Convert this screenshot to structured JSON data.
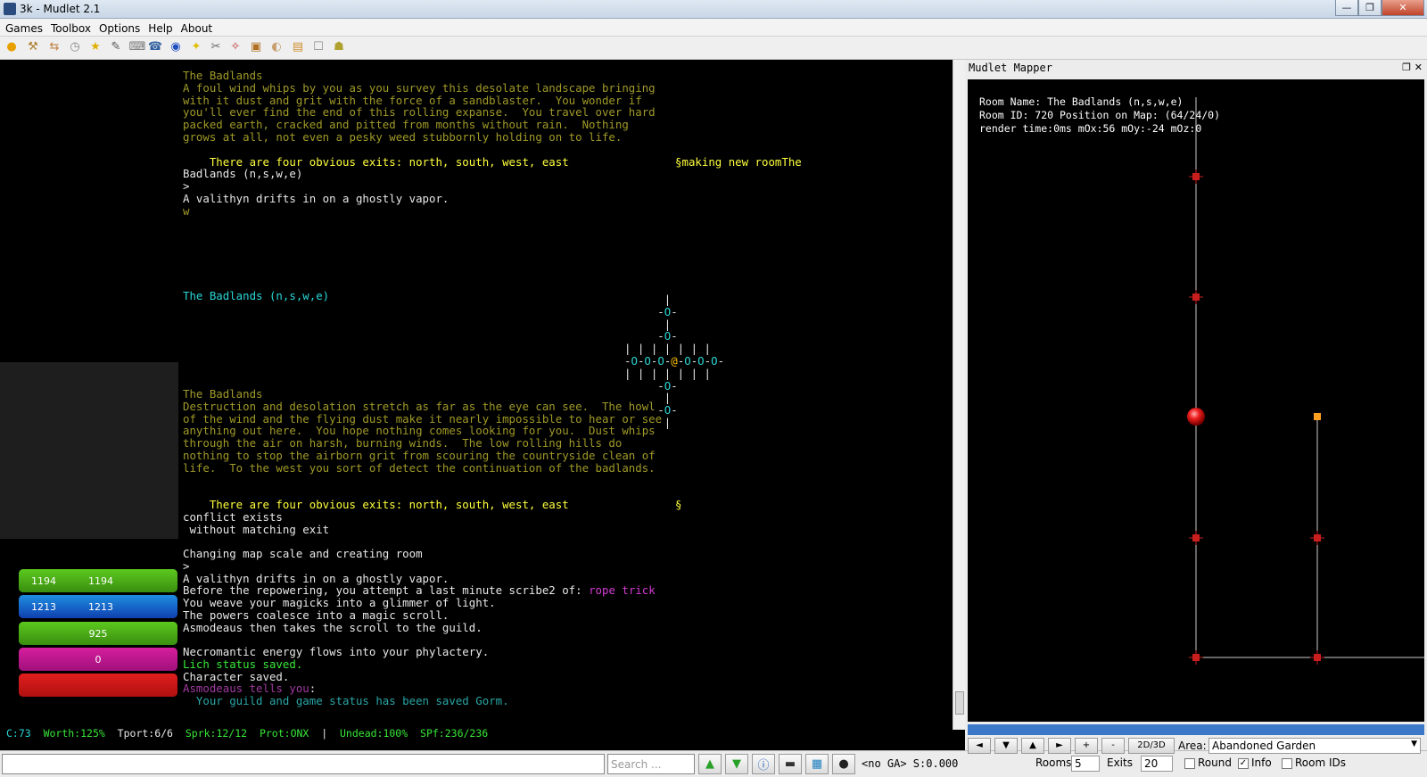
{
  "window": {
    "title": "3k - Mudlet 2.1",
    "minimize": "—",
    "maximize": "❐",
    "close": "✕"
  },
  "menu": [
    "Games",
    "Toolbox",
    "Options",
    "Help",
    "About"
  ],
  "console": {
    "lines": [
      {
        "text": "The Badlands",
        "color": "dim"
      },
      {
        "text": "A foul wind whips by you as you survey this desolate landscape bringing",
        "color": "dim"
      },
      {
        "text": "with it dust and grit with the force of a sandblaster.  You wonder if",
        "color": "dim"
      },
      {
        "text": "you'll ever find the end of this rolling expanse.  You travel over hard",
        "color": "dim"
      },
      {
        "text": "packed earth, cracked and pitted from months without rain.  Nothing",
        "color": "dim"
      },
      {
        "text": "grows at all, not even a pesky weed stubbornly holding on to life.",
        "color": "dim"
      },
      {
        "text": "",
        "color": "dim"
      },
      {
        "text": "    There are four obvious exits: north, south, west, east                §making new roomThe",
        "color": "yellow"
      },
      {
        "text": "Badlands (n,s,w,e)",
        "color": "white"
      },
      {
        "text": ">",
        "color": "white"
      },
      {
        "text": "A valithyn drifts in on a ghostly vapor.",
        "color": "white"
      },
      {
        "text": "w",
        "color": "dim"
      }
    ],
    "room_short": "The Badlands (n,s,w,e)",
    "lines2": [
      {
        "text": "The Badlands",
        "color": "dim"
      },
      {
        "text": "Destruction and desolation stretch as far as the eye can see.  The howl",
        "color": "dim"
      },
      {
        "text": "of the wind and the flying dust make it nearly impossible to hear or see",
        "color": "dim"
      },
      {
        "text": "anything out here.  You hope nothing comes looking for you.  Dust whips",
        "color": "dim"
      },
      {
        "text": "through the air on harsh, burning winds.  The low rolling hills do",
        "color": "dim"
      },
      {
        "text": "nothing to stop the airborn grit from scouring the countryside clean of",
        "color": "dim"
      },
      {
        "text": "life.  To the west you sort of detect the continuation of the badlands.",
        "color": "dim"
      }
    ],
    "lines3": [
      {
        "text": "    There are four obvious exits: north, south, west, east                §",
        "color": "yellow"
      },
      {
        "text": "conflict exists",
        "color": "white"
      },
      {
        "text": " without matching exit",
        "color": "white"
      },
      {
        "text": "",
        "color": "white"
      },
      {
        "text": "Changing map scale and creating room",
        "color": "white"
      },
      {
        "text": ">",
        "color": "white"
      },
      {
        "text": "A valithyn drifts in on a ghostly vapor.",
        "color": "white"
      }
    ],
    "scribe_prefix": "Before the repowering, you attempt a last minute scribe2 of: ",
    "scribe_spell": "rope trick",
    "lines4": [
      {
        "text": "You weave your magicks into a glimmer of light.",
        "color": "white"
      },
      {
        "text": "The powers coalesce into a magic scroll.",
        "color": "white"
      },
      {
        "text": "Asmodeaus then takes the scroll to the guild.",
        "color": "white"
      },
      {
        "text": "",
        "color": "white"
      },
      {
        "text": "Necromantic energy flows into your phylactery.",
        "color": "white"
      },
      {
        "text": "Lich status saved.",
        "color": "green"
      },
      {
        "text": "Character saved.",
        "color": "white"
      }
    ],
    "tell_name": "Asmodeaus tells you",
    "tell_colon": ":",
    "tell_msg": "  Your guild and game status has been saved Gorm."
  },
  "minimap": {
    "rows": [
      "      |",
      "     -O-",
      "      |",
      "     -O-",
      "| | | | | | |",
      "-O-O-O-@-O-O-O-",
      "| | | | | | |",
      "     -O-",
      "      |",
      "     -O-",
      "      |"
    ]
  },
  "gauges": [
    {
      "left": "1194",
      "right": "1194",
      "color": "#5cc81e",
      "dark": "#3a8e10",
      "fraction": 1.0
    },
    {
      "left": "1213",
      "right": "1213",
      "color": "#1e8ee0",
      "dark": "#1040b0",
      "fraction": 1.0
    },
    {
      "center": "925",
      "color": "#5cc81e",
      "dark": "#3a8e10",
      "fraction": 1.0
    },
    {
      "center": "0",
      "color": "#d61e9e",
      "dark": "#a0107a",
      "fraction": 1.0
    },
    {
      "center": "",
      "color": "#e01e1e",
      "dark": "#b01010",
      "fraction": 1.0
    }
  ],
  "status": {
    "c": "C:73",
    "worth": "Worth:125%",
    "tport": "Tport:6/6",
    "sprk": "Sprk:12/12",
    "prot": "Prot:ONX",
    "sep": "|",
    "undead": "Undead:100%",
    "spf": "SPf:236/236"
  },
  "input": {
    "search_placeholder": "Search ...",
    "ga_info": "<no GA> S:0.000"
  },
  "mapper": {
    "title": "Mudlet Mapper",
    "room_name": "Room Name: The Badlands (n,s,w,e)",
    "room_id": "Room ID: 720 Position on Map: (64/24/0)",
    "render": "render time:0ms mOx:56 mOy:-24 mOz:0",
    "buttons": [
      "◄",
      "▼",
      "▲",
      "►",
      "+",
      "-"
    ],
    "mode_button": "2D/3D",
    "area_label": "Area:",
    "area_value": "Abandoned Garden",
    "rooms_label": "Rooms",
    "rooms_value": "5",
    "exits_label": "Exits",
    "exits_value": "20",
    "round_label": "Round",
    "info_label": "Info",
    "roomids_label": "Room IDs",
    "colors": {
      "room": "#c81e1e",
      "orange": "#ffa020",
      "line": "#cccccc"
    }
  }
}
